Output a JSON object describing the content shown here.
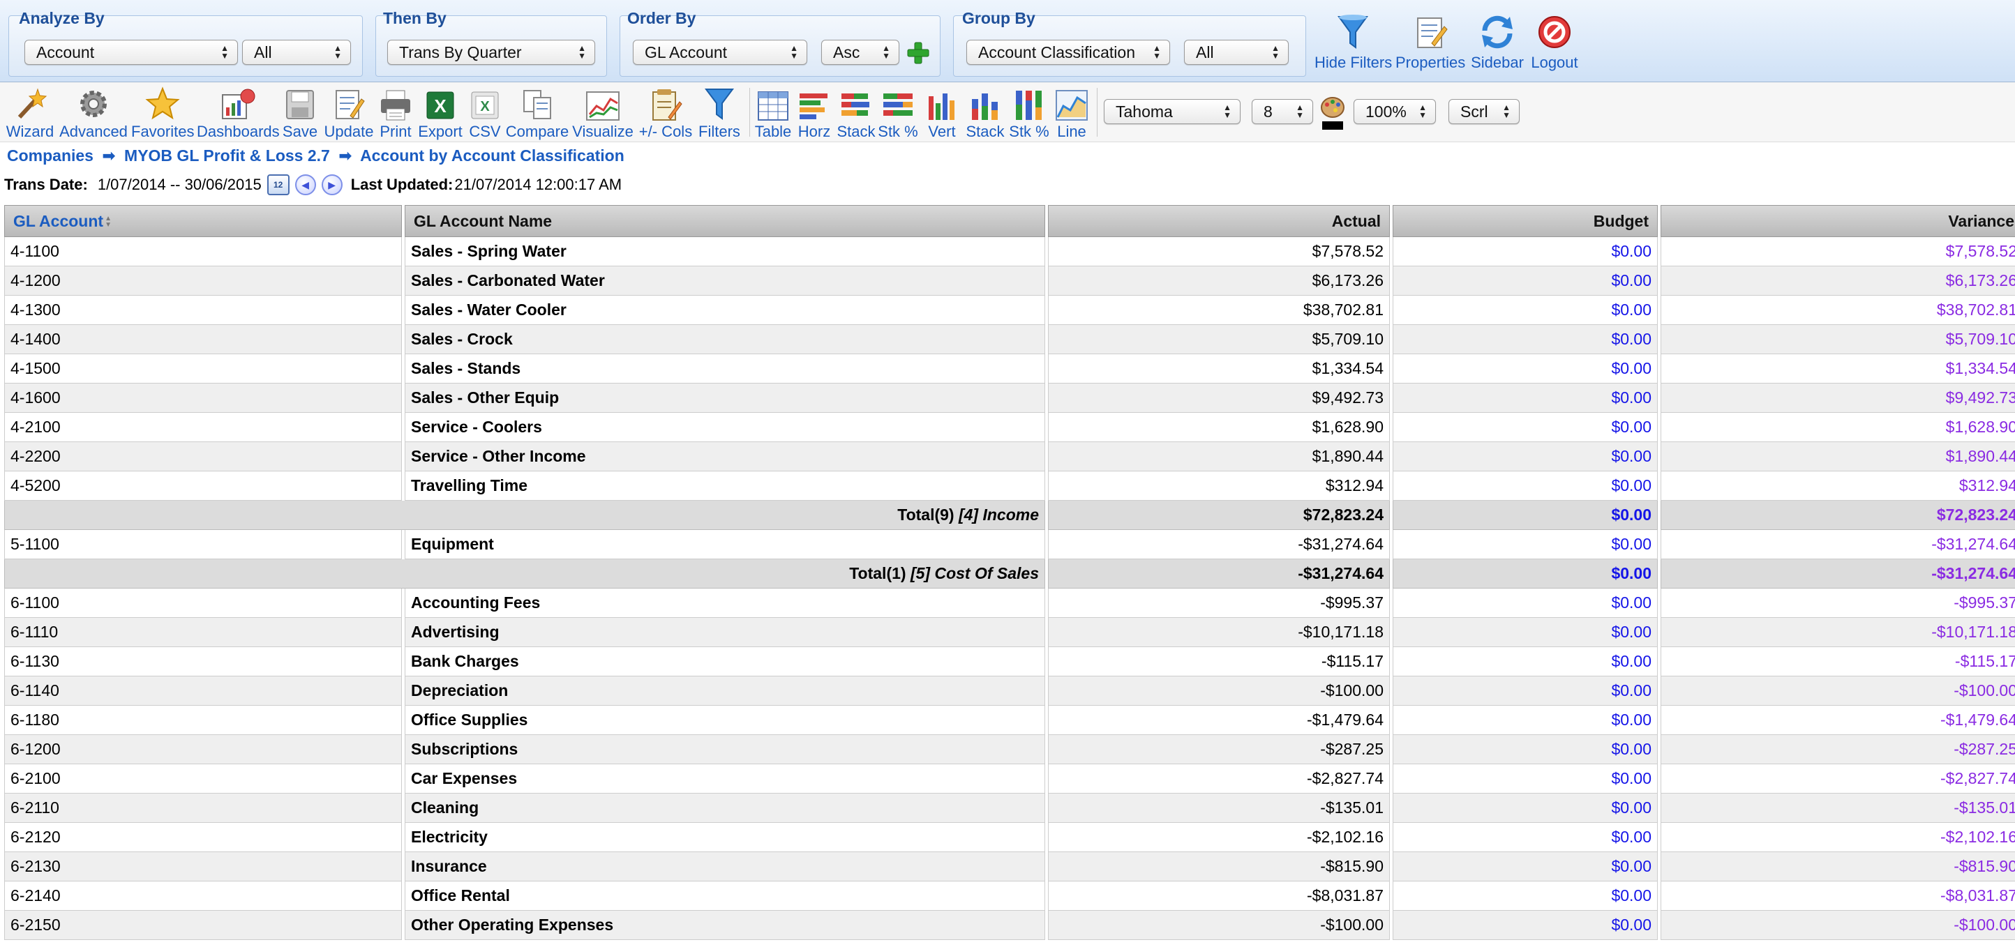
{
  "filters": {
    "analyze_by": {
      "title": "Analyze By",
      "field": "Account",
      "value": "All"
    },
    "then_by": {
      "title": "Then By",
      "field": "Trans By Quarter"
    },
    "order_by": {
      "title": "Order By",
      "field": "GL Account",
      "direction": "Asc"
    },
    "group_by": {
      "title": "Group By",
      "field": "Account Classification",
      "value": "All"
    }
  },
  "top_actions": {
    "hide_filters": "Hide Filters",
    "properties": "Properties",
    "sidebar": "Sidebar",
    "logout": "Logout"
  },
  "toolbar": {
    "wizard": "Wizard",
    "advanced": "Advanced",
    "favorites": "Favorites",
    "dashboards": "Dashboards",
    "save": "Save",
    "update": "Update",
    "print": "Print",
    "export": "Export",
    "csv": "CSV",
    "compare": "Compare",
    "visualize": "Visualize",
    "cols": "+/- Cols",
    "filters": "Filters",
    "table": "Table",
    "horz": "Horz",
    "stack1": "Stack",
    "stkpct1": "Stk %",
    "vert": "Vert",
    "stack2": "Stack",
    "stkpct2": "Stk %",
    "line": "Line",
    "font": "Tahoma",
    "font_size": "8",
    "zoom": "100%",
    "scroll": "Scrl"
  },
  "breadcrumb": {
    "item1": "Companies",
    "item2": "MYOB GL Profit & Loss 2.7",
    "item3": "Account by Account Classification",
    "arrow": "➡"
  },
  "trans": {
    "label": "Trans Date:",
    "range": "1/07/2014 -- 30/06/2015",
    "updated_label": "Last Updated:",
    "updated": "21/07/2014 12:00:17 AM"
  },
  "table": {
    "headers": {
      "account": "GL Account",
      "name": "GL Account Name",
      "actual": "Actual",
      "budget": "Budget",
      "variance": "Variance"
    },
    "rows": [
      {
        "type": "data",
        "account": "4-1100",
        "name": "Sales - Spring Water",
        "actual": "$7,578.52",
        "budget": "$0.00",
        "variance": "$7,578.52"
      },
      {
        "type": "data",
        "account": "4-1200",
        "name": "Sales - Carbonated Water",
        "actual": "$6,173.26",
        "budget": "$0.00",
        "variance": "$6,173.26"
      },
      {
        "type": "data",
        "account": "4-1300",
        "name": "Sales - Water Cooler",
        "actual": "$38,702.81",
        "budget": "$0.00",
        "variance": "$38,702.81"
      },
      {
        "type": "data",
        "account": "4-1400",
        "name": "Sales - Crock",
        "actual": "$5,709.10",
        "budget": "$0.00",
        "variance": "$5,709.10"
      },
      {
        "type": "data",
        "account": "4-1500",
        "name": "Sales - Stands",
        "actual": "$1,334.54",
        "budget": "$0.00",
        "variance": "$1,334.54"
      },
      {
        "type": "data",
        "account": "4-1600",
        "name": "Sales - Other Equip",
        "actual": "$9,492.73",
        "budget": "$0.00",
        "variance": "$9,492.73"
      },
      {
        "type": "data",
        "account": "4-2100",
        "name": "Service - Coolers",
        "actual": "$1,628.90",
        "budget": "$0.00",
        "variance": "$1,628.90"
      },
      {
        "type": "data",
        "account": "4-2200",
        "name": "Service - Other Income",
        "actual": "$1,890.44",
        "budget": "$0.00",
        "variance": "$1,890.44"
      },
      {
        "type": "data",
        "account": "4-5200",
        "name": "Travelling Time",
        "actual": "$312.94",
        "budget": "$0.00",
        "variance": "$312.94"
      },
      {
        "type": "total",
        "label": "Total(9)",
        "group": "[4] Income",
        "actual": "$72,823.24",
        "budget": "$0.00",
        "variance": "$72,823.24"
      },
      {
        "type": "data",
        "account": "5-1100",
        "name": "Equipment",
        "actual": "-$31,274.64",
        "budget": "$0.00",
        "variance": "-$31,274.64"
      },
      {
        "type": "total",
        "label": "Total(1)",
        "group": "[5] Cost Of Sales",
        "actual": "-$31,274.64",
        "budget": "$0.00",
        "variance": "-$31,274.64"
      },
      {
        "type": "data",
        "account": "6-1100",
        "name": "Accounting Fees",
        "actual": "-$995.37",
        "budget": "$0.00",
        "variance": "-$995.37"
      },
      {
        "type": "data",
        "account": "6-1110",
        "name": "Advertising",
        "actual": "-$10,171.18",
        "budget": "$0.00",
        "variance": "-$10,171.18"
      },
      {
        "type": "data",
        "account": "6-1130",
        "name": "Bank Charges",
        "actual": "-$115.17",
        "budget": "$0.00",
        "variance": "-$115.17"
      },
      {
        "type": "data",
        "account": "6-1140",
        "name": "Depreciation",
        "actual": "-$100.00",
        "budget": "$0.00",
        "variance": "-$100.00"
      },
      {
        "type": "data",
        "account": "6-1180",
        "name": "Office Supplies",
        "actual": "-$1,479.64",
        "budget": "$0.00",
        "variance": "-$1,479.64"
      },
      {
        "type": "data",
        "account": "6-1200",
        "name": "Subscriptions",
        "actual": "-$287.25",
        "budget": "$0.00",
        "variance": "-$287.25"
      },
      {
        "type": "data",
        "account": "6-2100",
        "name": "Car Expenses",
        "actual": "-$2,827.74",
        "budget": "$0.00",
        "variance": "-$2,827.74"
      },
      {
        "type": "data",
        "account": "6-2110",
        "name": "Cleaning",
        "actual": "-$135.01",
        "budget": "$0.00",
        "variance": "-$135.01"
      },
      {
        "type": "data",
        "account": "6-2120",
        "name": "Electricity",
        "actual": "-$2,102.16",
        "budget": "$0.00",
        "variance": "-$2,102.16"
      },
      {
        "type": "data",
        "account": "6-2130",
        "name": "Insurance",
        "actual": "-$815.90",
        "budget": "$0.00",
        "variance": "-$815.90"
      },
      {
        "type": "data",
        "account": "6-2140",
        "name": "Office Rental",
        "actual": "-$8,031.87",
        "budget": "$0.00",
        "variance": "-$8,031.87"
      },
      {
        "type": "data",
        "account": "6-2150",
        "name": "Other Operating Expenses",
        "actual": "-$100.00",
        "budget": "$0.00",
        "variance": "-$100.00"
      }
    ]
  },
  "colors": {
    "link": "#1b5cc0",
    "budget": "#1515e8",
    "variance": "#8a2be2"
  }
}
